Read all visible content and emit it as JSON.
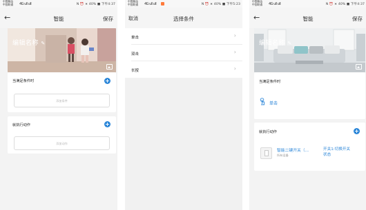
{
  "status_bar": {
    "carrier_line1": "中国移动",
    "carrier_line2": "中国联通",
    "signal": "4G ull ull",
    "right_info_1": "N ⏰ ∗ 40% ■ 下午4:37",
    "right_info_2": "N ⏰ ∗ 40% ■ 下午5:23",
    "right_info_3": "N ⏰ ∗ 40% ■ 下午4:37"
  },
  "screen1": {
    "back": "←",
    "title": "智能",
    "save": "保存",
    "banner_name": "编辑名称",
    "condition_label": "当满足条件时",
    "add_condition": "添加条件",
    "action_label": "就执行动作",
    "add_action": "添加动作",
    "plus": "+"
  },
  "screen2": {
    "cancel": "取消",
    "title": "选择条件",
    "items": [
      {
        "label": "单击"
      },
      {
        "label": "双击"
      },
      {
        "label": "长按"
      }
    ],
    "chevron": "›"
  },
  "screen3": {
    "back": "←",
    "title": "智能",
    "save": "保存",
    "banner_name": "编辑名称",
    "condition_label": "当满足条件时",
    "condition_value": "单击",
    "action_label": "就执行动作",
    "device_name": "智能二键开关（...",
    "device_room": "所有设备",
    "device_action_line1": "开关1:切换开关",
    "device_action_line2": "状态",
    "plus": "+"
  },
  "colors": {
    "accent": "#2b86d8",
    "page_bg": "#f3f3f3",
    "card_bg": "#ffffff"
  },
  "icons": {
    "edit": "pencil-icon",
    "image": "image-icon",
    "touch": "touch-icon",
    "device": "switch-device-icon"
  }
}
